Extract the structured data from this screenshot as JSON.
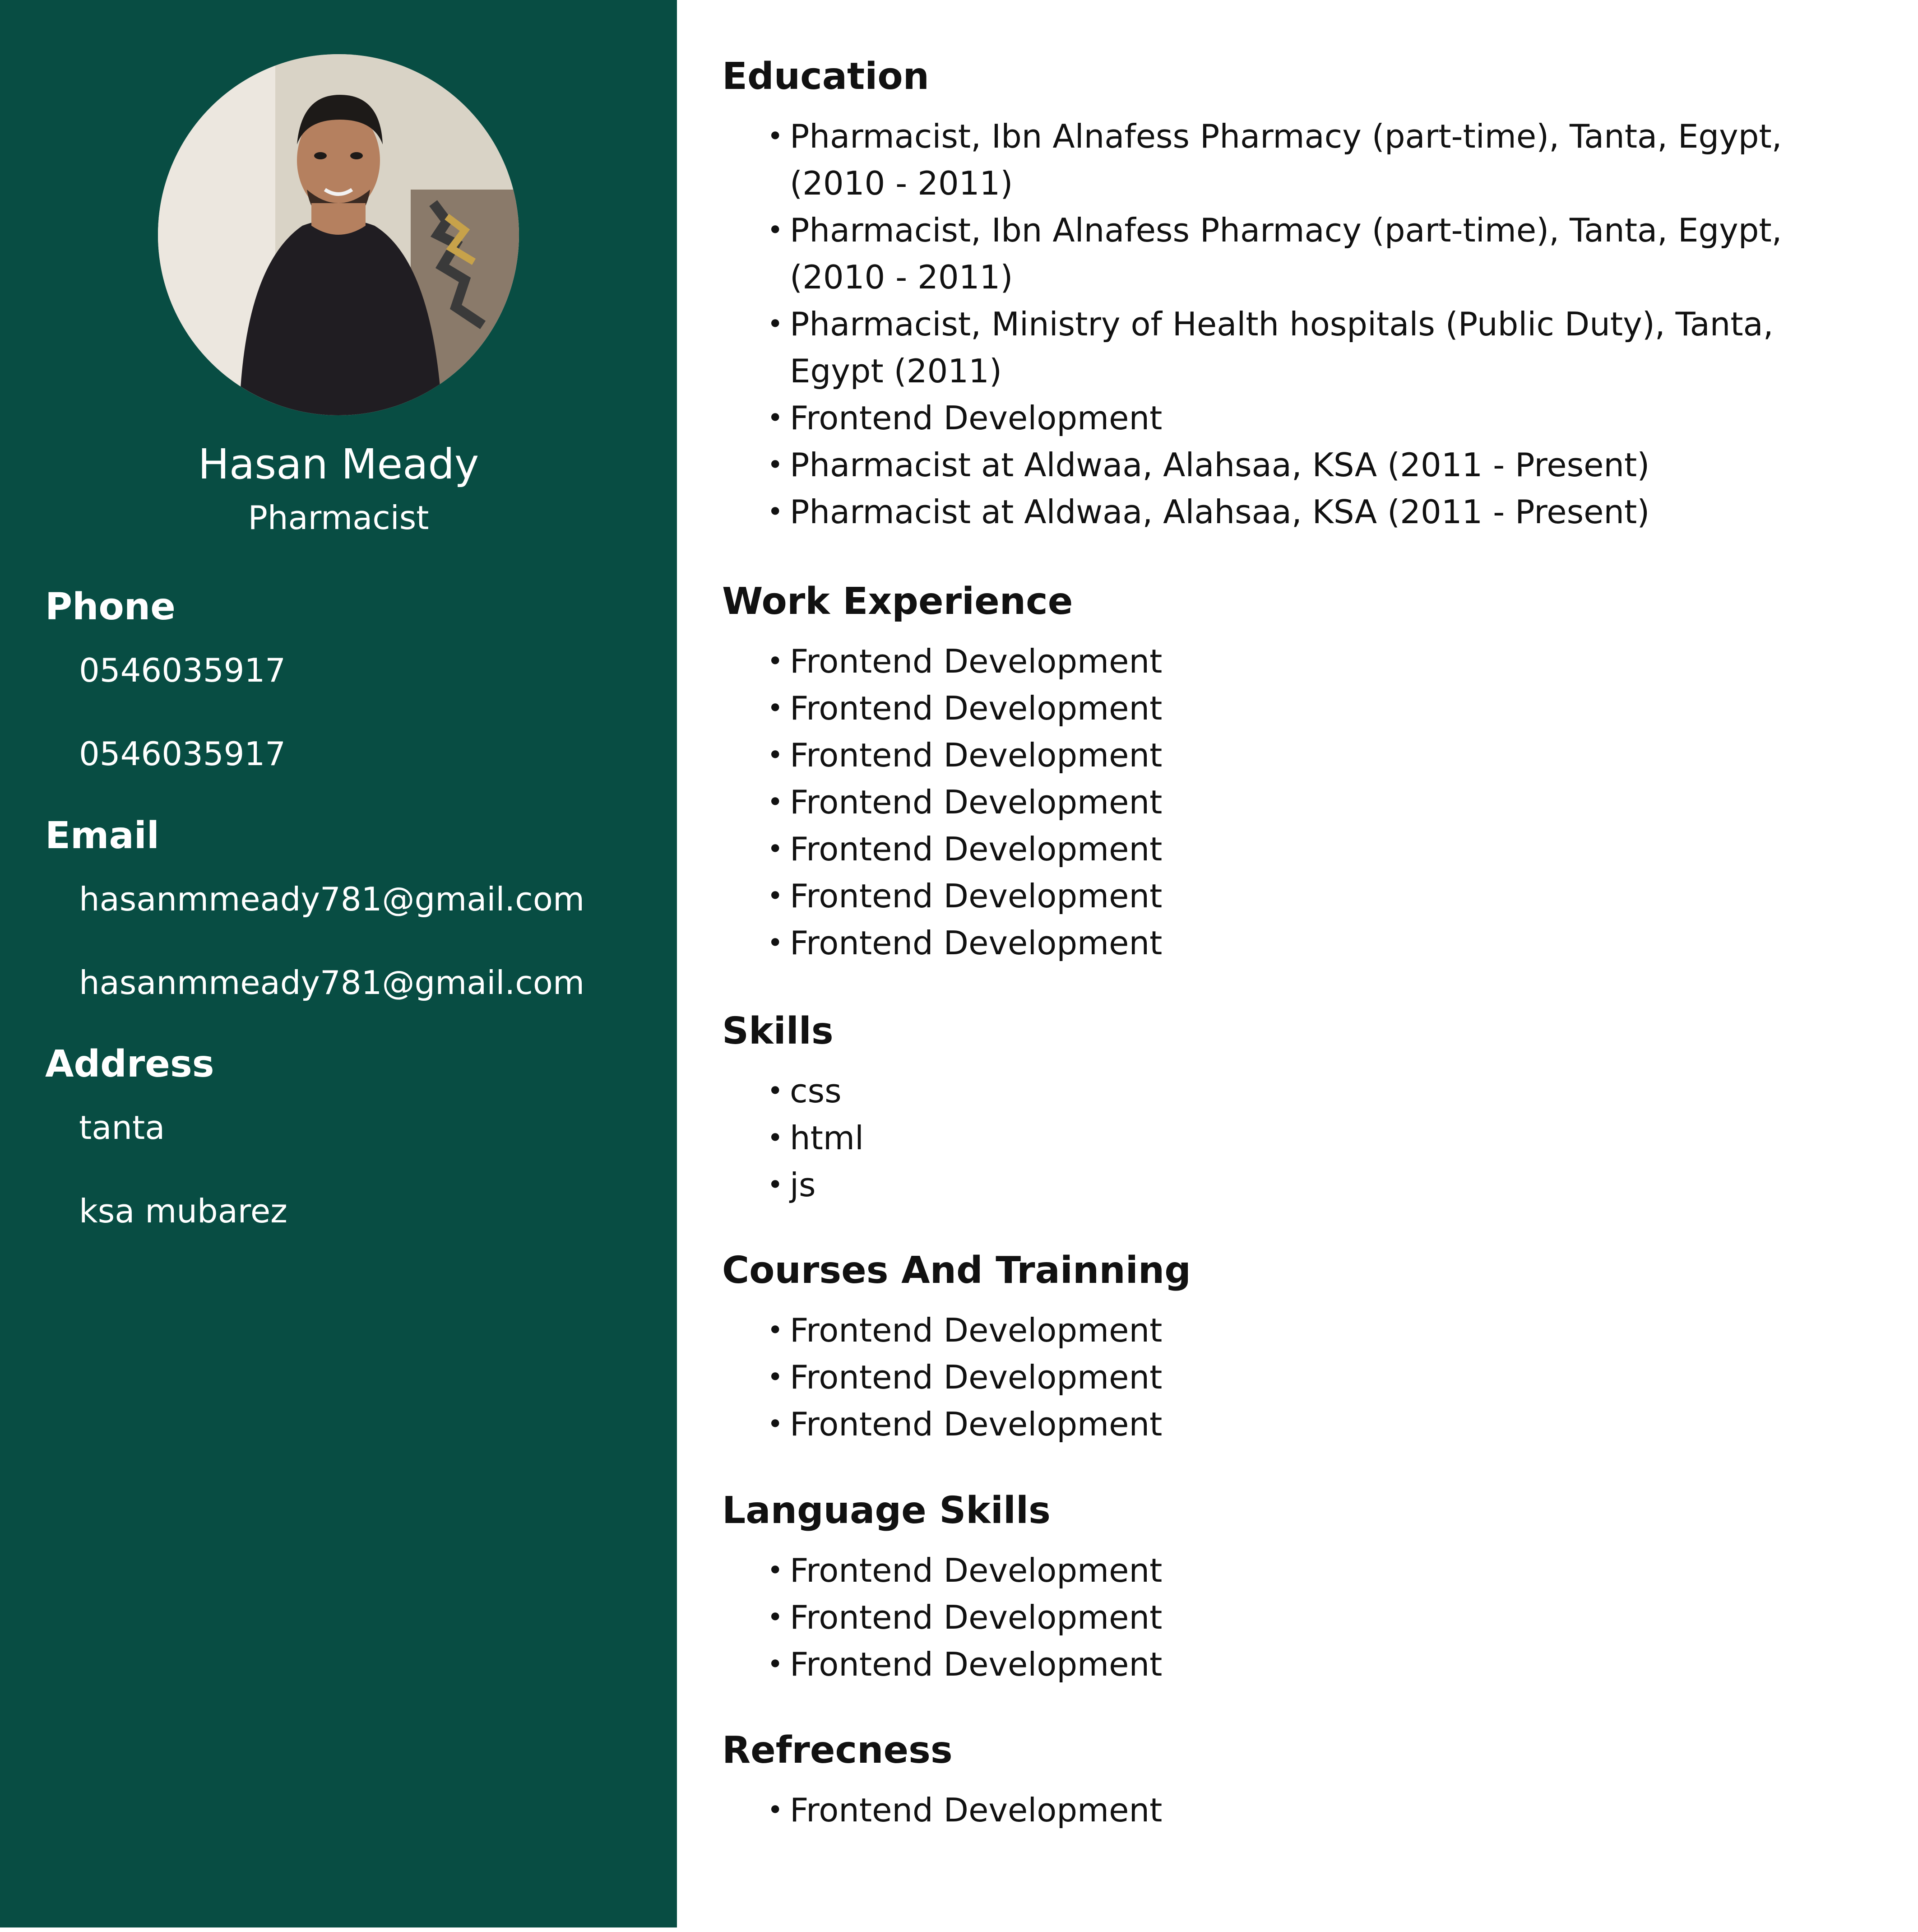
{
  "profile": {
    "name": "Hasan Meady",
    "title": "Pharmacist"
  },
  "contact": {
    "phone_heading": "Phone",
    "phones": [
      "0546035917",
      "0546035917"
    ],
    "email_heading": "Email",
    "emails": [
      "hasanmmeady781@gmail.com",
      "hasanmmeady781@gmail.com"
    ],
    "address_heading": "Address",
    "addresses": [
      "tanta",
      "ksa mubarez"
    ]
  },
  "sections": {
    "education": {
      "heading": "Education",
      "items": [
        "Pharmacist, Ibn Alnafess Pharmacy (part-time), Tanta, Egypt, (2010 - 2011)",
        "Pharmacist, Ibn Alnafess Pharmacy (part-time), Tanta, Egypt, (2010 - 2011)",
        "Pharmacist, Ministry of Health hospitals (Public Duty), Tanta, Egypt (2011)",
        "Frontend Development",
        "Pharmacist at Aldwaa, Alahsaa, KSA (2011 - Present)",
        "Pharmacist at Aldwaa, Alahsaa, KSA (2011 - Present)"
      ]
    },
    "work": {
      "heading": "Work Experience",
      "items": [
        "Frontend Development",
        "Frontend Development",
        "Frontend Development",
        "Frontend Development",
        "Frontend Development",
        "Frontend Development",
        "Frontend Development"
      ]
    },
    "skills": {
      "heading": "Skills",
      "items": [
        "css",
        "html",
        "js"
      ]
    },
    "courses": {
      "heading": "Courses And Trainning",
      "items": [
        "Frontend Development",
        "Frontend Development",
        "Frontend Development"
      ]
    },
    "languages": {
      "heading": "Language Skills",
      "items": [
        "Frontend Development",
        "Frontend Development",
        "Frontend Development"
      ]
    },
    "references": {
      "heading": "Refrecness",
      "items": [
        "Frontend Development"
      ]
    }
  },
  "colors": {
    "sidebar_bg": "#084d43",
    "text_dark": "#111111",
    "text_light": "#ffffff"
  },
  "icons": {
    "avatar": "profile-photo"
  }
}
